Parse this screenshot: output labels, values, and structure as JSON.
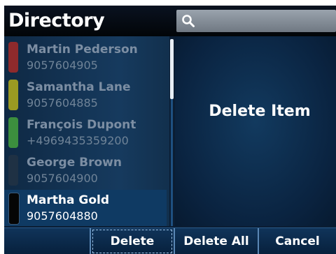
{
  "header": {
    "title": "Directory",
    "search_placeholder": ""
  },
  "contacts": [
    {
      "name": "Martin Pederson",
      "number": "9057604905",
      "color": "#8e2a2c",
      "selected": false
    },
    {
      "name": "Samantha Lane",
      "number": "9057604885",
      "color": "#9a9a22",
      "selected": false
    },
    {
      "name": "François Dupont",
      "number": "+4969435359200",
      "color": "#3c8e3e",
      "selected": false
    },
    {
      "name": "George Brown",
      "number": "9057604900",
      "color": "#1f3144",
      "selected": false
    },
    {
      "name": "Martha Gold",
      "number": "9057604880",
      "color": "#050505",
      "selected": true
    }
  ],
  "panel": {
    "message": "Delete Item"
  },
  "softkeys": {
    "empty": "",
    "delete": "Delete",
    "delete_all": "Delete All",
    "cancel": "Cancel"
  },
  "icons": {
    "search": "search-icon"
  },
  "colors": {
    "background": "#0b1d33",
    "header": "#020508",
    "selected_row": "#0f3a63",
    "dim_text": "#7c8ea3"
  }
}
